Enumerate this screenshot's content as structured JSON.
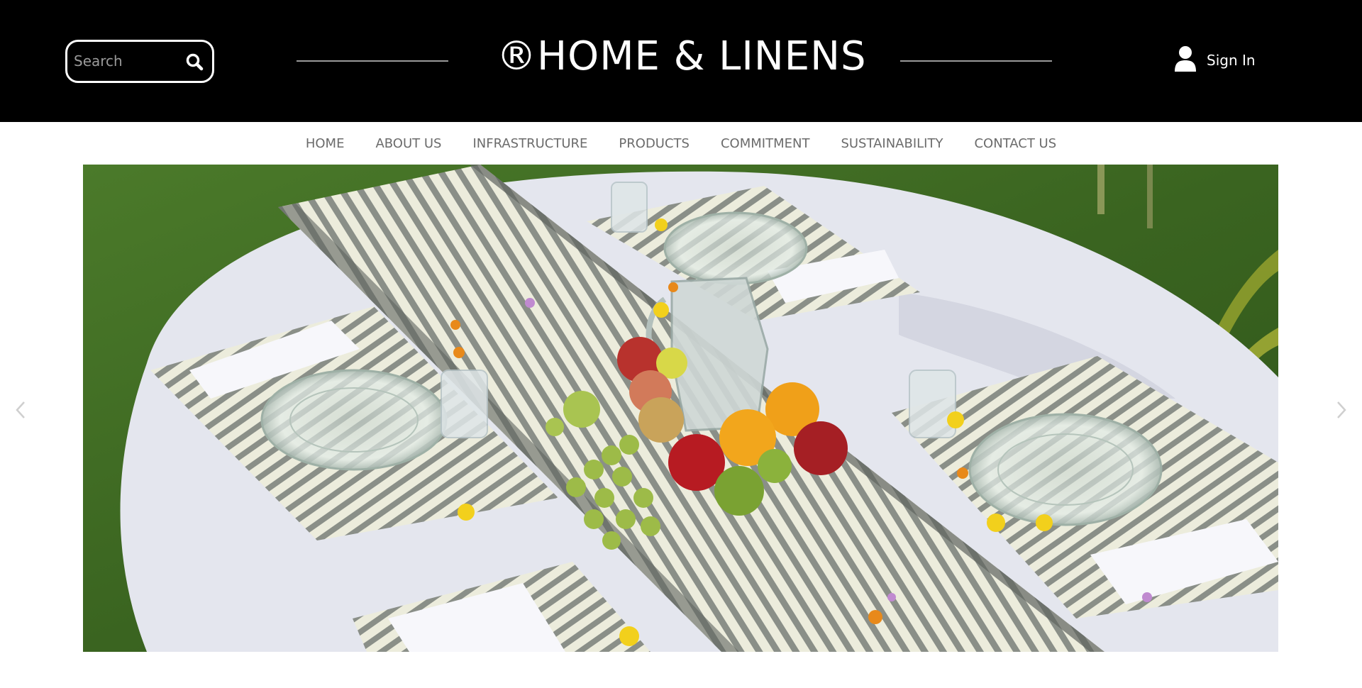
{
  "header": {
    "logo_text": "®HOME & LINENS",
    "search": {
      "placeholder": "Search",
      "value": ""
    },
    "signin_label": "Sign In"
  },
  "nav": {
    "items": [
      {
        "label": "HOME"
      },
      {
        "label": "ABOUT US"
      },
      {
        "label": "INFRASTRUCTURE"
      },
      {
        "label": "PRODUCTS"
      },
      {
        "label": "COMMITMENT"
      },
      {
        "label": "SUSTAINABILITY"
      },
      {
        "label": "CONTACT US"
      }
    ]
  },
  "hero": {
    "image_subject": "outdoor round table set with striped runner, placemats, glass plates, water jug and fruit on grass",
    "prev_icon": "chevron-left-icon",
    "next_icon": "chevron-right-icon"
  },
  "colors": {
    "header_bg": "#000000",
    "nav_text": "#6b6b6b",
    "grass": "#3f6b24",
    "tablecloth": "#e4e6ee"
  }
}
